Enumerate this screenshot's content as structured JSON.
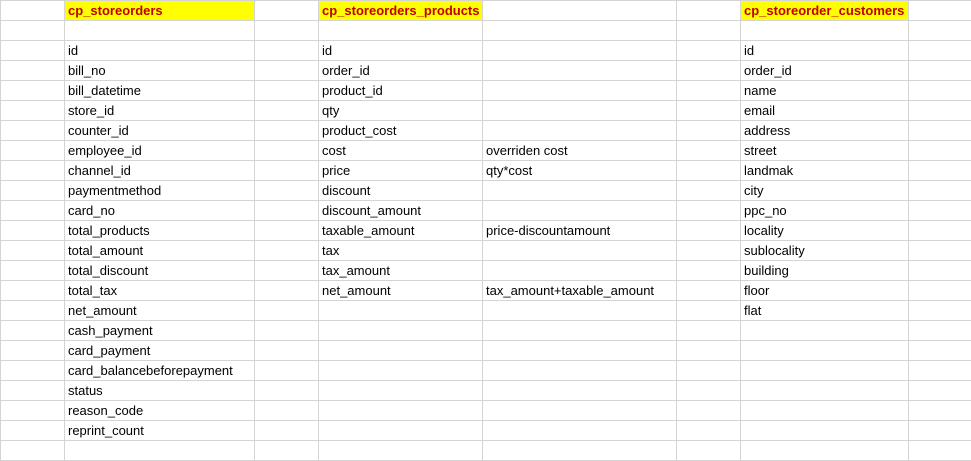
{
  "sheet": {
    "headers": {
      "storeorders": "cp_storeorders",
      "products": "cp_storeorders_products",
      "customers": "cp_storeorder_customers"
    },
    "storeorders_fields": [
      "id",
      "bill_no",
      "bill_datetime",
      "store_id",
      "counter_id",
      "employee_id",
      "channel_id",
      "paymentmethod",
      "card_no",
      "total_products",
      "total_amount",
      "total_discount",
      "total_tax",
      "net_amount",
      "cash_payment",
      "card_payment",
      "card_balancebeforepayment",
      "status",
      "reason_code",
      "reprint_count"
    ],
    "products_fields": [
      "id",
      "order_id",
      "product_id",
      "qty",
      "product_cost",
      "cost",
      "price",
      "discount",
      "discount_amount",
      "taxable_amount",
      "tax",
      "tax_amount",
      "net_amount"
    ],
    "products_notes": [
      "",
      "",
      "",
      "",
      "",
      "overriden cost",
      "qty*cost",
      "",
      "",
      "price-discountamount",
      "",
      "",
      "tax_amount+taxable_amount"
    ],
    "customers_fields": [
      "id",
      "order_id",
      "name",
      "email",
      "address",
      "street",
      "landmak",
      "city",
      "ppc_no",
      "locality",
      "sublocality",
      "building",
      "floor",
      "flat"
    ]
  }
}
